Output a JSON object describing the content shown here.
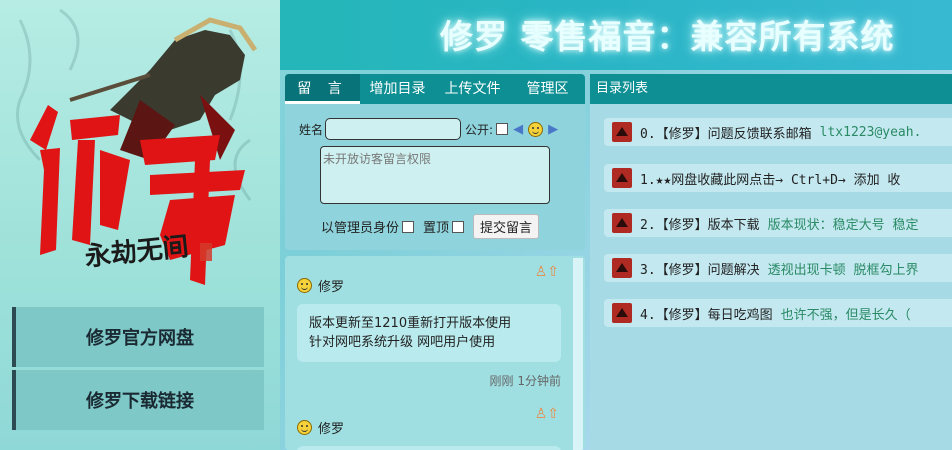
{
  "sidebar": {
    "logo_text": "修羅",
    "logo_subtitle": "永劫无间",
    "nav": [
      {
        "label": "修罗官方网盘"
      },
      {
        "label": "修罗下载链接"
      }
    ]
  },
  "header": {
    "title": "修罗 零售福音：兼容所有系统"
  },
  "message_panel": {
    "tabs": [
      {
        "label": "留 言"
      },
      {
        "label": "增加目录"
      },
      {
        "label": "上传文件"
      },
      {
        "label": "管理区"
      }
    ],
    "name_label": "姓名",
    "name_value": "",
    "public_label": "公开:",
    "message_placeholder": "未开放访客留言权限",
    "admin_label": "以管理员身份",
    "pin_label": "置顶",
    "submit_label": "提交留言"
  },
  "messages": [
    {
      "author": "修罗",
      "lines": [
        "版本更新至1210重新打开版本使用",
        "针对网吧系统升级 网吧用户使用"
      ],
      "time": "刚刚 1分钟前"
    },
    {
      "author": "修罗",
      "lines": [],
      "time": ""
    }
  ],
  "directory": {
    "title": "目录列表",
    "items": [
      {
        "title": "0.【修罗】问题反馈联系邮箱",
        "desc": "ltx1223@yeah."
      },
      {
        "title": "1.★★网盘收藏此网点击→ Ctrl+D→ 添加 收",
        "desc": ""
      },
      {
        "title": "2.【修罗】版本下载",
        "desc": "版本现状：稳定大号 稳定"
      },
      {
        "title": "3.【修罗】问题解决",
        "desc": "透视出现卡顿 脱框勾上界"
      },
      {
        "title": "4.【修罗】每日吃鸡图",
        "desc": "也许不强，但是长久（"
      }
    ]
  },
  "colors": {
    "accent": "#0e8f94",
    "nav_border": "#2d4a52",
    "desc_green": "#2a8a64"
  }
}
